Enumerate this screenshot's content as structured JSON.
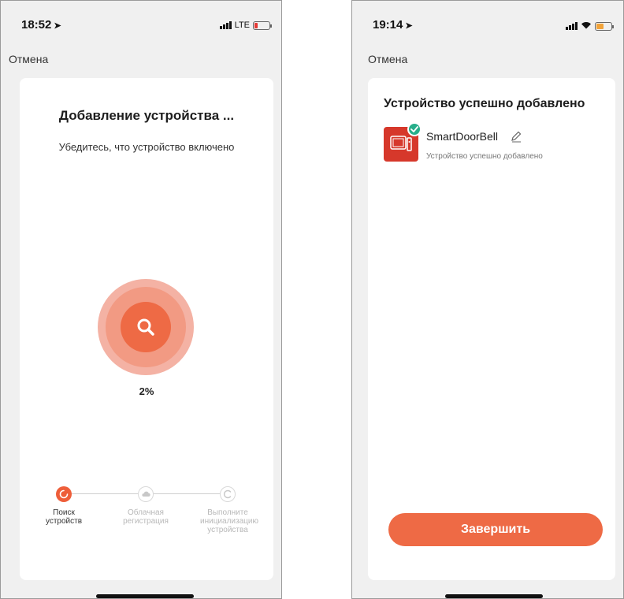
{
  "left_screen": {
    "status_bar": {
      "time": "18:52",
      "network": "LTE"
    },
    "cancel_label": "Отмена",
    "title": "Добавление устройства ...",
    "subtitle": "Убедитесь, что устройство включено",
    "progress": {
      "percent_label": "2%",
      "value": 0.02
    },
    "steps": [
      {
        "label": "Поиск устройств",
        "state": "active"
      },
      {
        "label": "Облачная регистрация",
        "state": "pending"
      },
      {
        "label": "Выполните инициализацию устройства",
        "state": "pending"
      }
    ]
  },
  "right_screen": {
    "status_bar": {
      "time": "19:14"
    },
    "cancel_label": "Отмена",
    "title": "Устройство успешно добавлено",
    "device": {
      "name": "SmartDoorBell",
      "status": "Устройство успешно добавлено"
    },
    "finish_label": "Завершить"
  },
  "colors": {
    "accent": "#ee6a45",
    "device_icon": "#d6382b",
    "success_check": "#27ae8a",
    "battery_low": "#e53935"
  }
}
